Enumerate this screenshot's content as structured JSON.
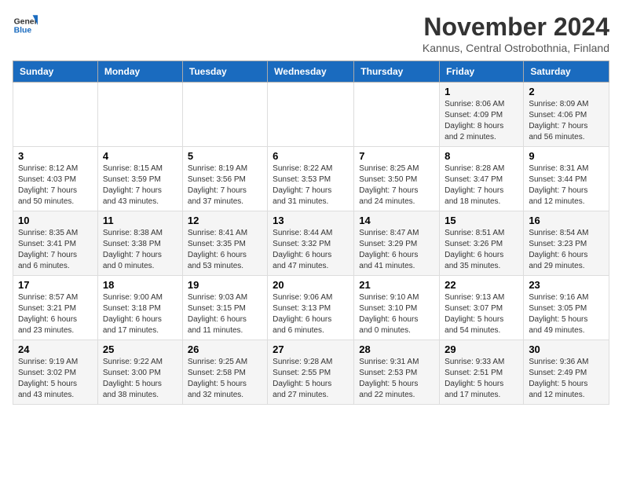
{
  "logo": {
    "line1": "General",
    "line2": "Blue"
  },
  "title": "November 2024",
  "location": "Kannus, Central Ostrobothnia, Finland",
  "days_of_week": [
    "Sunday",
    "Monday",
    "Tuesday",
    "Wednesday",
    "Thursday",
    "Friday",
    "Saturday"
  ],
  "weeks": [
    [
      {
        "day": "",
        "info": ""
      },
      {
        "day": "",
        "info": ""
      },
      {
        "day": "",
        "info": ""
      },
      {
        "day": "",
        "info": ""
      },
      {
        "day": "",
        "info": ""
      },
      {
        "day": "1",
        "info": "Sunrise: 8:06 AM\nSunset: 4:09 PM\nDaylight: 8 hours\nand 2 minutes."
      },
      {
        "day": "2",
        "info": "Sunrise: 8:09 AM\nSunset: 4:06 PM\nDaylight: 7 hours\nand 56 minutes."
      }
    ],
    [
      {
        "day": "3",
        "info": "Sunrise: 8:12 AM\nSunset: 4:03 PM\nDaylight: 7 hours\nand 50 minutes."
      },
      {
        "day": "4",
        "info": "Sunrise: 8:15 AM\nSunset: 3:59 PM\nDaylight: 7 hours\nand 43 minutes."
      },
      {
        "day": "5",
        "info": "Sunrise: 8:19 AM\nSunset: 3:56 PM\nDaylight: 7 hours\nand 37 minutes."
      },
      {
        "day": "6",
        "info": "Sunrise: 8:22 AM\nSunset: 3:53 PM\nDaylight: 7 hours\nand 31 minutes."
      },
      {
        "day": "7",
        "info": "Sunrise: 8:25 AM\nSunset: 3:50 PM\nDaylight: 7 hours\nand 24 minutes."
      },
      {
        "day": "8",
        "info": "Sunrise: 8:28 AM\nSunset: 3:47 PM\nDaylight: 7 hours\nand 18 minutes."
      },
      {
        "day": "9",
        "info": "Sunrise: 8:31 AM\nSunset: 3:44 PM\nDaylight: 7 hours\nand 12 minutes."
      }
    ],
    [
      {
        "day": "10",
        "info": "Sunrise: 8:35 AM\nSunset: 3:41 PM\nDaylight: 7 hours\nand 6 minutes."
      },
      {
        "day": "11",
        "info": "Sunrise: 8:38 AM\nSunset: 3:38 PM\nDaylight: 7 hours\nand 0 minutes."
      },
      {
        "day": "12",
        "info": "Sunrise: 8:41 AM\nSunset: 3:35 PM\nDaylight: 6 hours\nand 53 minutes."
      },
      {
        "day": "13",
        "info": "Sunrise: 8:44 AM\nSunset: 3:32 PM\nDaylight: 6 hours\nand 47 minutes."
      },
      {
        "day": "14",
        "info": "Sunrise: 8:47 AM\nSunset: 3:29 PM\nDaylight: 6 hours\nand 41 minutes."
      },
      {
        "day": "15",
        "info": "Sunrise: 8:51 AM\nSunset: 3:26 PM\nDaylight: 6 hours\nand 35 minutes."
      },
      {
        "day": "16",
        "info": "Sunrise: 8:54 AM\nSunset: 3:23 PM\nDaylight: 6 hours\nand 29 minutes."
      }
    ],
    [
      {
        "day": "17",
        "info": "Sunrise: 8:57 AM\nSunset: 3:21 PM\nDaylight: 6 hours\nand 23 minutes."
      },
      {
        "day": "18",
        "info": "Sunrise: 9:00 AM\nSunset: 3:18 PM\nDaylight: 6 hours\nand 17 minutes."
      },
      {
        "day": "19",
        "info": "Sunrise: 9:03 AM\nSunset: 3:15 PM\nDaylight: 6 hours\nand 11 minutes."
      },
      {
        "day": "20",
        "info": "Sunrise: 9:06 AM\nSunset: 3:13 PM\nDaylight: 6 hours\nand 6 minutes."
      },
      {
        "day": "21",
        "info": "Sunrise: 9:10 AM\nSunset: 3:10 PM\nDaylight: 6 hours\nand 0 minutes."
      },
      {
        "day": "22",
        "info": "Sunrise: 9:13 AM\nSunset: 3:07 PM\nDaylight: 5 hours\nand 54 minutes."
      },
      {
        "day": "23",
        "info": "Sunrise: 9:16 AM\nSunset: 3:05 PM\nDaylight: 5 hours\nand 49 minutes."
      }
    ],
    [
      {
        "day": "24",
        "info": "Sunrise: 9:19 AM\nSunset: 3:02 PM\nDaylight: 5 hours\nand 43 minutes."
      },
      {
        "day": "25",
        "info": "Sunrise: 9:22 AM\nSunset: 3:00 PM\nDaylight: 5 hours\nand 38 minutes."
      },
      {
        "day": "26",
        "info": "Sunrise: 9:25 AM\nSunset: 2:58 PM\nDaylight: 5 hours\nand 32 minutes."
      },
      {
        "day": "27",
        "info": "Sunrise: 9:28 AM\nSunset: 2:55 PM\nDaylight: 5 hours\nand 27 minutes."
      },
      {
        "day": "28",
        "info": "Sunrise: 9:31 AM\nSunset: 2:53 PM\nDaylight: 5 hours\nand 22 minutes."
      },
      {
        "day": "29",
        "info": "Sunrise: 9:33 AM\nSunset: 2:51 PM\nDaylight: 5 hours\nand 17 minutes."
      },
      {
        "day": "30",
        "info": "Sunrise: 9:36 AM\nSunset: 2:49 PM\nDaylight: 5 hours\nand 12 minutes."
      }
    ]
  ]
}
